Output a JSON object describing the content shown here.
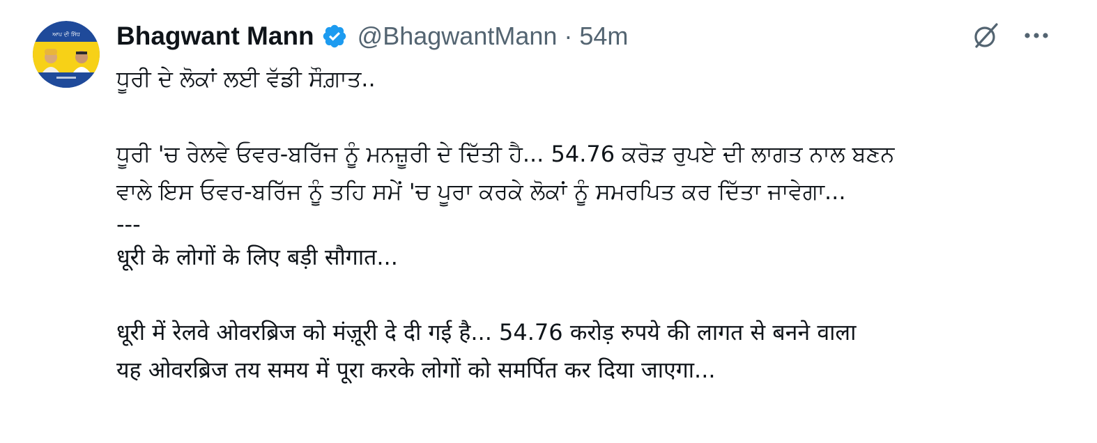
{
  "tweet": {
    "author": {
      "display_name": "Bhagwant Mann",
      "handle": "@BhagwantMann",
      "separator": "·",
      "time": "54m",
      "avatar_label": "ਆਪ ਦੀ ਸਿੱਧ"
    },
    "icons": {
      "verified": "verified-badge-icon",
      "grok": "grok-icon",
      "more": "more-icon"
    },
    "colors": {
      "verified": "#1d9bf0",
      "secondary_text": "#536471",
      "primary_text": "#0f1419",
      "avatar_yellow": "#f7d117",
      "avatar_blue": "#1f4a9a"
    },
    "text": {
      "p_title": "ਧੂਰੀ ਦੇ ਲੋਕਾਂ ਲਈ ਵੱਡੀ ਸੌਗ਼ਾਤ..",
      "p_line1": "ਧੂਰੀ 'ਚ ਰੇਲਵੇ ਓਵਰ-ਬਰਿੱਜ ਨੂੰ ਮਨਜ਼ੂਰੀ ਦੇ ਦਿੱਤੀ ਹੈ... 54.76 ਕਰੋੜ ਰੁਪਏ ਦੀ ਲਾਗਤ ਨਾਲ ਬਣਨ",
      "p_line2": "ਵਾਲੇ ਇਸ ਓਵਰ-ਬਰਿੱਜ ਨੂੰ ਤਹਿ ਸਮੇਂ 'ਚ ਪੂਰਾ ਕਰਕੇ ਲੋਕਾਂ ਨੂੰ ਸਮਰਪਿਤ ਕਰ ਦਿੱਤਾ ਜਾਵੇਗਾ...",
      "divider": "---",
      "h_title": "धूरी के लोगों के लिए बड़ी सौगात...",
      "h_line1": "धूरी में रेलवे ओवरब्रिज को मंज़ूरी दे दी गई है... 54.76 करोड़ रुपये की लागत से बनने वाला",
      "h_line2": "यह ओवरब्रिज तय समय में पूरा करके लोगों को समर्पित कर दिया जाएगा..."
    }
  }
}
